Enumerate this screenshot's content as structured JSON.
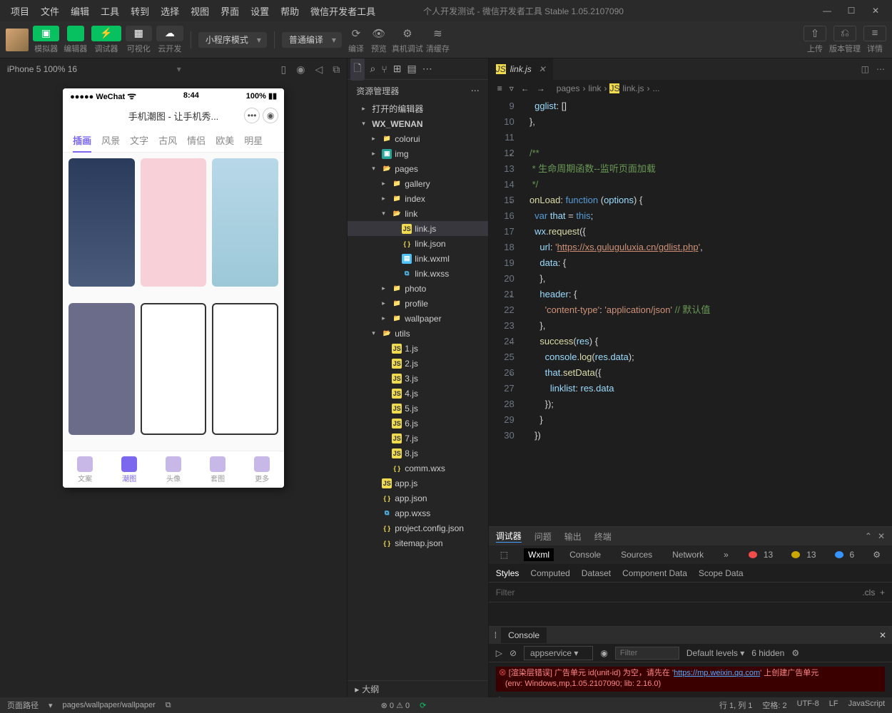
{
  "menubar": [
    "项目",
    "文件",
    "编辑",
    "工具",
    "转到",
    "选择",
    "视图",
    "界面",
    "设置",
    "帮助",
    "微信开发者工具"
  ],
  "window_title": "个人开发测试 - 微信开发者工具 Stable 1.05.2107090",
  "toolbar": {
    "groups": [
      {
        "icon": "▣",
        "label": "模拟器",
        "green": true
      },
      {
        "icon": "</>",
        "label": "编辑器",
        "green": true
      },
      {
        "icon": "⚡",
        "label": "调试器",
        "green": true
      },
      {
        "icon": "▦",
        "label": "可视化",
        "green": false
      },
      {
        "icon": "☁",
        "label": "云开发",
        "green": false
      }
    ],
    "mode_select": "小程序模式",
    "compile_select": "普通编译",
    "mid_btns": [
      {
        "icon": "⟳",
        "label": "编译"
      },
      {
        "icon": "👁",
        "label": "预览"
      },
      {
        "icon": "⚙",
        "label": "真机调试"
      },
      {
        "icon": "≋",
        "label": "清缓存"
      }
    ],
    "right_btns": [
      {
        "icon": "⇧",
        "label": "上传"
      },
      {
        "icon": "⎌",
        "label": "版本管理"
      },
      {
        "icon": "≡",
        "label": "详情"
      }
    ]
  },
  "simulator": {
    "device": "iPhone 5 100% 16",
    "status_left": "●●●●● WeChat",
    "status_time": "8:44",
    "status_batt": "100%",
    "app_title": "手机潮图 - 让手机秀...",
    "tabs": [
      "插画",
      "风景",
      "文字",
      "古风",
      "情侣",
      "欧美",
      "明星"
    ],
    "active_tab": "插画",
    "nav": [
      "文案",
      "潮图",
      "头像",
      "套图",
      "更多"
    ],
    "active_nav": "潮图"
  },
  "explorer": {
    "header": "资源管理器",
    "root_sections": [
      "打开的编辑器",
      "WX_WENAN"
    ],
    "tree": [
      {
        "d": 2,
        "t": "folder",
        "chev": "▸",
        "name": "colorui"
      },
      {
        "d": 2,
        "t": "img",
        "chev": "▸",
        "name": "img"
      },
      {
        "d": 2,
        "t": "folder",
        "chev": "▾",
        "name": "pages",
        "open": true
      },
      {
        "d": 3,
        "t": "folder",
        "chev": "▸",
        "name": "gallery"
      },
      {
        "d": 3,
        "t": "folder",
        "chev": "▸",
        "name": "index"
      },
      {
        "d": 3,
        "t": "folder",
        "chev": "▾",
        "name": "link",
        "open": true
      },
      {
        "d": 4,
        "t": "js",
        "name": "link.js",
        "selected": true
      },
      {
        "d": 4,
        "t": "json",
        "name": "link.json"
      },
      {
        "d": 4,
        "t": "wxml",
        "name": "link.wxml"
      },
      {
        "d": 4,
        "t": "wxss",
        "name": "link.wxss"
      },
      {
        "d": 3,
        "t": "folder",
        "chev": "▸",
        "name": "photo"
      },
      {
        "d": 3,
        "t": "folder",
        "chev": "▸",
        "name": "profile"
      },
      {
        "d": 3,
        "t": "folder",
        "chev": "▸",
        "name": "wallpaper"
      },
      {
        "d": 2,
        "t": "folder",
        "chev": "▾",
        "name": "utils",
        "open": true
      },
      {
        "d": 3,
        "t": "js",
        "name": "1.js"
      },
      {
        "d": 3,
        "t": "js",
        "name": "2.js"
      },
      {
        "d": 3,
        "t": "js",
        "name": "3.js"
      },
      {
        "d": 3,
        "t": "js",
        "name": "4.js"
      },
      {
        "d": 3,
        "t": "js",
        "name": "5.js"
      },
      {
        "d": 3,
        "t": "js",
        "name": "6.js"
      },
      {
        "d": 3,
        "t": "js",
        "name": "7.js"
      },
      {
        "d": 3,
        "t": "js",
        "name": "8.js"
      },
      {
        "d": 3,
        "t": "json",
        "name": "comm.wxs"
      },
      {
        "d": 2,
        "t": "js",
        "name": "app.js"
      },
      {
        "d": 2,
        "t": "json",
        "name": "app.json"
      },
      {
        "d": 2,
        "t": "wxss",
        "name": "app.wxss"
      },
      {
        "d": 2,
        "t": "json",
        "name": "project.config.json"
      },
      {
        "d": 2,
        "t": "json",
        "name": "sitemap.json"
      }
    ],
    "outline": "大纲"
  },
  "editor": {
    "tab_name": "link.js",
    "breadcrumb": [
      "pages",
      "link",
      "link.js",
      "..."
    ],
    "line_start": 9,
    "lines": [
      "    gglist: []",
      "  },",
      "",
      "  /**",
      "   * 生命周期函数--监听页面加载",
      "   */",
      "  onLoad: function (options) {",
      "    var that = this;",
      "    wx.request({",
      "      url: 'https://xs.guluguluxia.cn/gdlist.php',",
      "      data: {",
      "      },",
      "      header: {",
      "        'content-type': 'application/json' // 默认值",
      "      },",
      "      success(res) {",
      "        console.log(res.data);",
      "        that.setData({",
      "          linklist: res.data",
      "        });",
      "      }",
      "    })"
    ],
    "folds": [
      12,
      15,
      21,
      24,
      26
    ]
  },
  "debugger": {
    "tabs": [
      "调试器",
      "问题",
      "输出",
      "终端"
    ],
    "active_tab": "调试器",
    "tools": [
      "Wxml",
      "Console",
      "Sources",
      "Network"
    ],
    "active_tool": "Wxml",
    "badge_err": "13",
    "badge_warn": "13",
    "badge_info": "6",
    "subtabs": [
      "Styles",
      "Computed",
      "Dataset",
      "Component Data",
      "Scope Data"
    ],
    "active_subtab": "Styles",
    "filter_placeholder": "Filter",
    "cls": ".cls"
  },
  "console": {
    "title": "Console",
    "context": "appservice",
    "filter_placeholder": "Filter",
    "levels": "Default levels",
    "hidden": "6 hidden",
    "error_line1": "[渲染层错误] 广告单元 id(unit-id) 为空，请先在 '",
    "error_url": "https://mp.weixin.qq.com",
    "error_line1b": "' 上创建广告单元",
    "error_line2": "(env: Windows,mp,1.05.2107090; lib: 2.16.0)"
  },
  "statusbar": {
    "left_label": "页面路径",
    "path": "pages/wallpaper/wallpaper",
    "warn": "0",
    "err": "0",
    "right": [
      "行 1, 列 1",
      "空格: 2",
      "UTF-8",
      "LF",
      "JavaScript"
    ]
  }
}
